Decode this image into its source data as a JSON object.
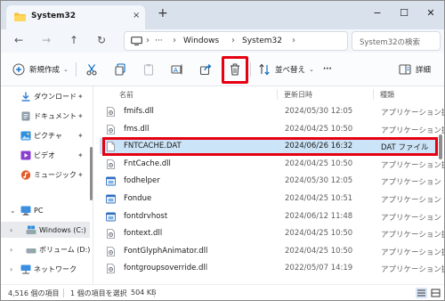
{
  "tab": {
    "title": "System32",
    "close_icon": "×",
    "new_tab_icon": "+"
  },
  "window_controls": {
    "minimize": "−",
    "maximize": "☐",
    "close": "✕"
  },
  "address": {
    "parts": [
      "Windows",
      "System32"
    ],
    "separator": "›",
    "overflow": "···",
    "search_placeholder": "System32の検索"
  },
  "toolbar": {
    "new_label": "新規作成",
    "sort_label": "並べ替え",
    "more_label": "···",
    "details_label": "詳細"
  },
  "nav_pane": {
    "quick_access": [
      {
        "label": "ダウンロード",
        "icon": "download-icon",
        "color": "#2b7bd6"
      },
      {
        "label": "ドキュメント",
        "icon": "documents-icon",
        "color": "#5b6b7c"
      },
      {
        "label": "ピクチャ",
        "icon": "pictures-icon",
        "color": "#2f8fe0"
      },
      {
        "label": "ビデオ",
        "icon": "videos-icon",
        "color": "#8a3fd1"
      },
      {
        "label": "ミュージック",
        "icon": "music-icon",
        "color": "#e35b2a"
      }
    ],
    "pc_label": "PC",
    "drives": [
      {
        "label": "Windows (C:)",
        "icon": "drive-icon"
      },
      {
        "label": "ボリューム (D:)",
        "icon": "drive-icon"
      }
    ],
    "network_label": "ネットワーク"
  },
  "columns": {
    "name": "名前",
    "modified": "更新日時",
    "type": "種類"
  },
  "files": [
    {
      "name": "fmifs.dll",
      "modified": "2024/05/30 12:05",
      "type": "アプリケーション拡張",
      "icon": "dll-icon",
      "selected": false
    },
    {
      "name": "fms.dll",
      "modified": "2024/04/25 10:50",
      "type": "アプリケーション拡張",
      "icon": "dll-icon",
      "selected": false
    },
    {
      "name": "FNTCACHE.DAT",
      "modified": "2024/06/26 16:32",
      "type": "DAT ファイル",
      "icon": "file-icon",
      "selected": true
    },
    {
      "name": "FntCache.dll",
      "modified": "2024/04/25 10:50",
      "type": "アプリケーション拡張",
      "icon": "dll-icon",
      "selected": false
    },
    {
      "name": "fodhelper",
      "modified": "2024/05/30 12:05",
      "type": "アプリケーション",
      "icon": "exe-icon",
      "selected": false
    },
    {
      "name": "Fondue",
      "modified": "2024/04/25 10:51",
      "type": "アプリケーション",
      "icon": "exe-icon",
      "selected": false
    },
    {
      "name": "fontdrvhost",
      "modified": "2024/06/12 11:48",
      "type": "アプリケーション",
      "icon": "exe-icon",
      "selected": false
    },
    {
      "name": "fontext.dll",
      "modified": "2024/04/25 10:50",
      "type": "アプリケーション拡張",
      "icon": "dll-icon",
      "selected": false
    },
    {
      "name": "FontGlyphAnimator.dll",
      "modified": "2024/04/25 10:50",
      "type": "アプリケーション拡張",
      "icon": "dll-icon",
      "selected": false
    },
    {
      "name": "fontgroupsoverride.dll",
      "modified": "2022/05/07 14:19",
      "type": "アプリケーション拡張",
      "icon": "dll-icon",
      "selected": false
    }
  ],
  "status": {
    "item_count": "4,516 個の項目",
    "selection": "1 個の項目を選択",
    "size": "504 KB"
  },
  "colors": {
    "accent": "#0067c0",
    "highlight_red": "#e50012",
    "selection_bg": "#cce4f7",
    "folder_yellow": "#f3c23c"
  }
}
